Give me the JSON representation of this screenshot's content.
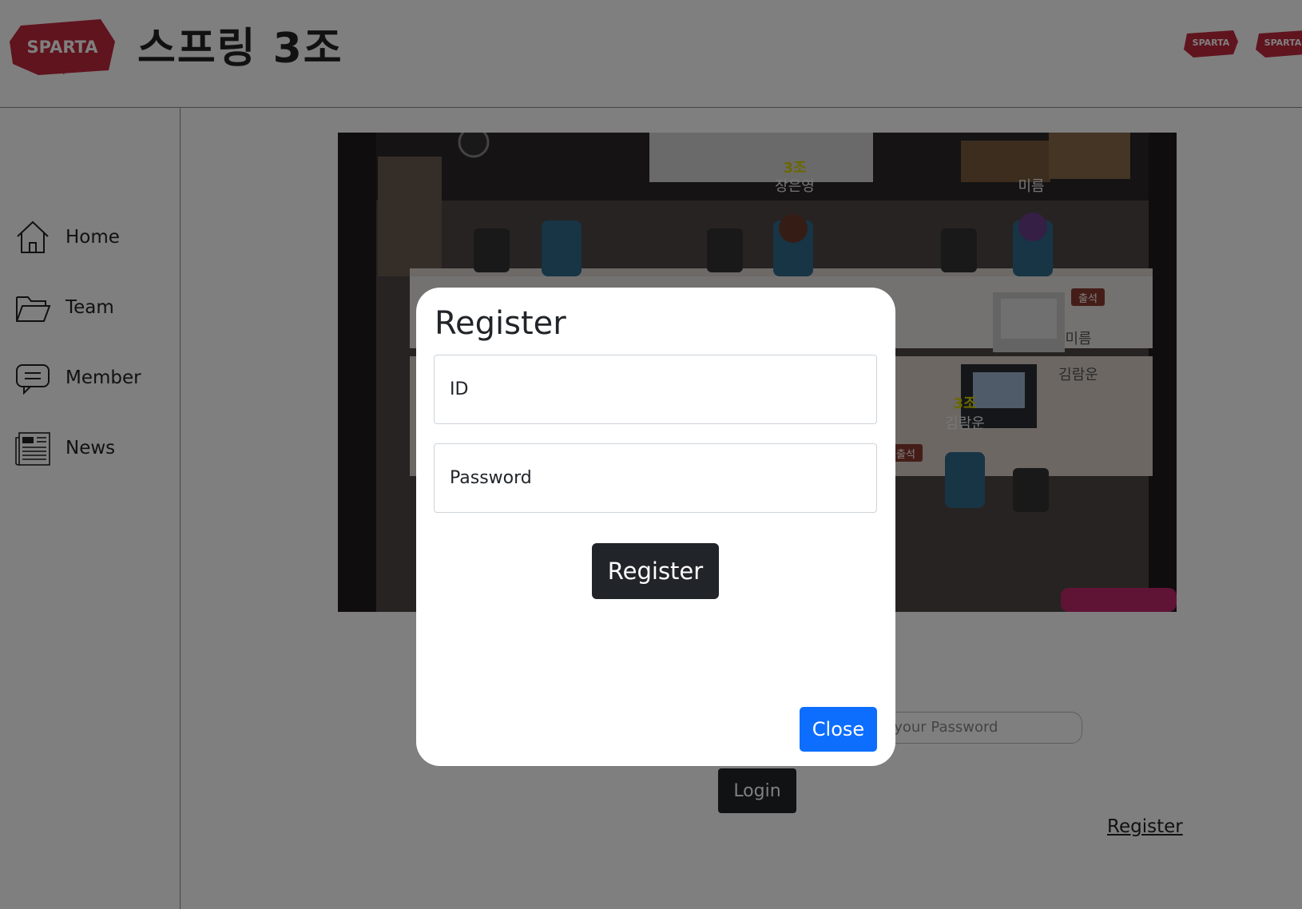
{
  "header": {
    "logo_text": "SPARTA",
    "title": "스프링 3조",
    "mini_logo_text": "SPARTA"
  },
  "sidebar": {
    "items": [
      {
        "label": "Home",
        "icon": "home-icon"
      },
      {
        "label": "Team",
        "icon": "folder-icon"
      },
      {
        "label": "Member",
        "icon": "chat-icon"
      },
      {
        "label": "News",
        "icon": "newspaper-icon"
      }
    ]
  },
  "hero": {
    "scene_labels": [
      "3조",
      "장은영",
      "미름",
      "미름",
      "김람운",
      "3조",
      "김람운",
      "출석",
      "출석"
    ]
  },
  "login_form": {
    "password_placeholder": "er your Password",
    "login_label": "Login",
    "register_link": "Register"
  },
  "modal": {
    "title": "Register",
    "id_placeholder": "ID",
    "password_placeholder": "Password",
    "submit_label": "Register",
    "close_label": "Close"
  },
  "colors": {
    "brand_red": "#c0283c",
    "dark_button": "#212529",
    "primary_blue": "#0d6efd",
    "backdrop": "rgba(0,0,0,0.5)"
  }
}
